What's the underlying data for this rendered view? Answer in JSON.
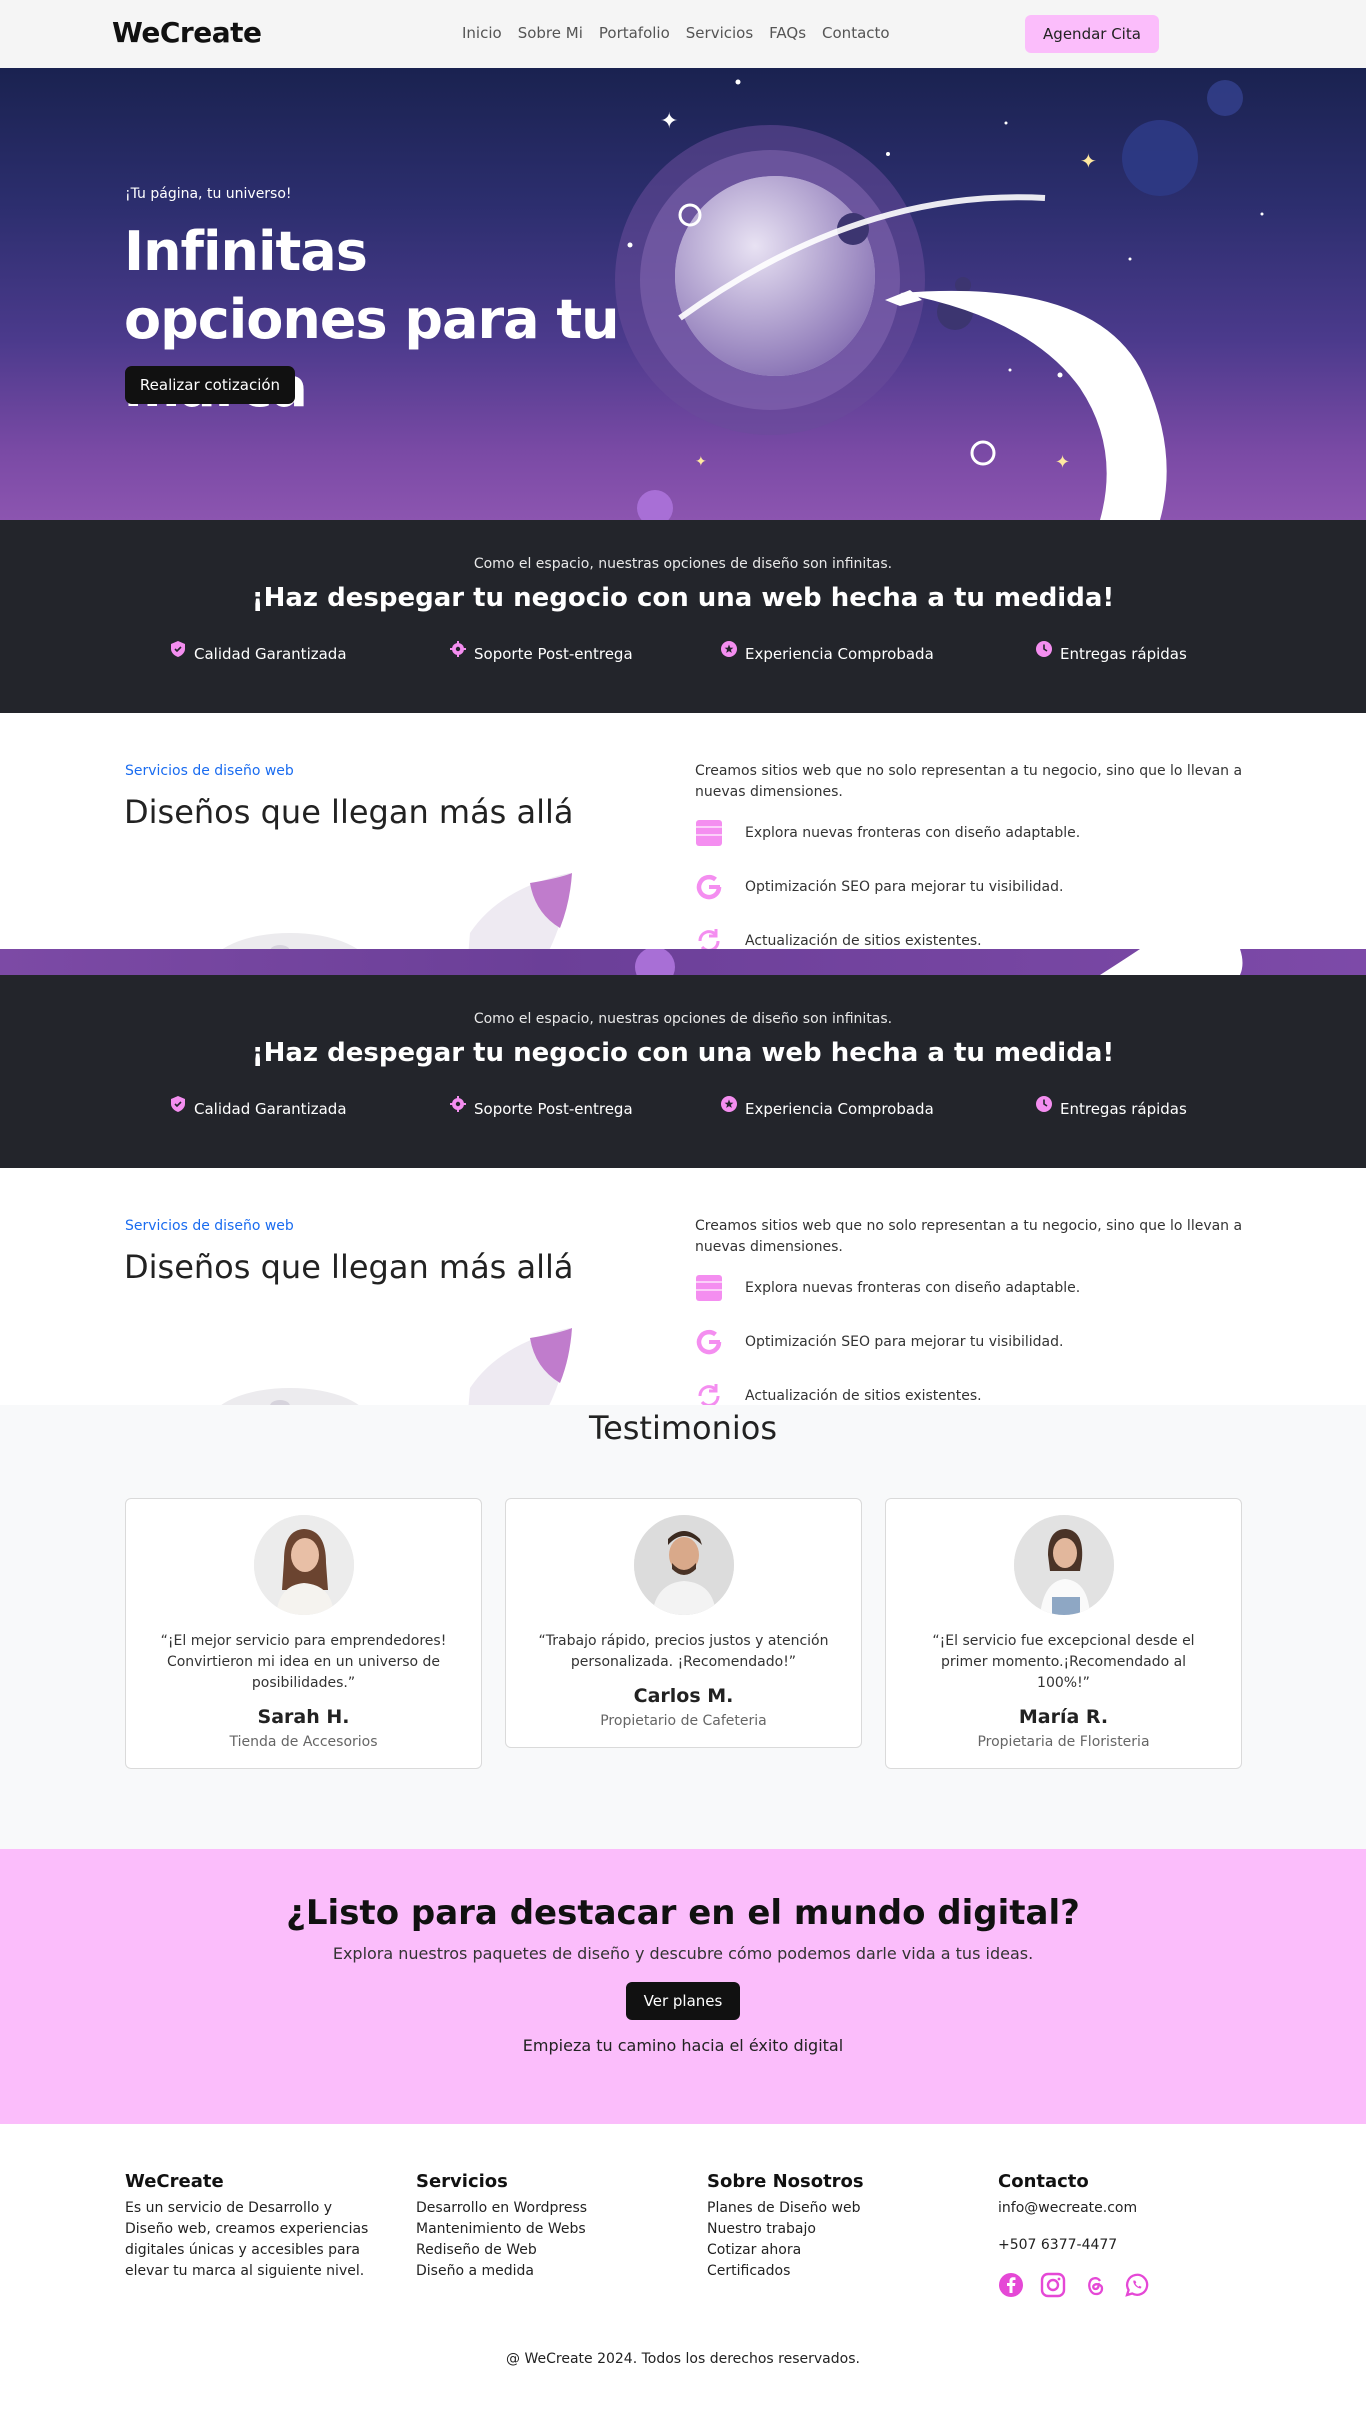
{
  "nav": {
    "brand": "WeCreate",
    "links": [
      "Inicio",
      "Sobre Mi",
      "Portafolio",
      "Servicios",
      "FAQs",
      "Contacto"
    ],
    "cta": "Agendar Cita"
  },
  "hero": {
    "tag": "¡Tu página, tu universo!",
    "title": "Infinitas opciones para tu marca",
    "button": "Realizar cotización"
  },
  "band": {
    "subtitle": "Como el espacio, nuestras opciones de diseño son infinitas.",
    "title": "¡Haz despegar tu negocio con una web hecha a tu medida!",
    "features": [
      {
        "icon": "shield-check-icon",
        "label": "Calidad Garantizada"
      },
      {
        "icon": "gear-icon",
        "label": "Soporte Post-entrega"
      },
      {
        "icon": "star-badge-icon",
        "label": "Experiencia Comprobada"
      },
      {
        "icon": "clock-icon",
        "label": "Entregas rápidas"
      }
    ]
  },
  "services": {
    "eyebrow": "Servicios de diseño web",
    "title": "Diseños que llegan más allá",
    "intro": "Creamos sitios web que no solo representan a tu negocio, sino que lo llevan a nuevas dimensiones.",
    "items": [
      {
        "icon": "layout-icon",
        "label": "Explora nuevas fronteras con diseño adaptable."
      },
      {
        "icon": "google-icon",
        "label": "Optimización SEO para mejorar tu visibilidad."
      },
      {
        "icon": "refresh-icon",
        "label": "Actualización de sitios existentes."
      }
    ]
  },
  "testimonials": {
    "title": "Testimonios",
    "items": [
      {
        "quote": "“¡El mejor servicio para emprendedores! Convirtieron mi idea en un universo de posibilidades.”",
        "name": "Sarah H.",
        "role": "Tienda de Accesorios"
      },
      {
        "quote": "“Trabajo rápido, precios justos y atención personalizada. ¡Recomendado!”",
        "name": "Carlos M.",
        "role": "Propietario de Cafeteria"
      },
      {
        "quote": "“¡El servicio fue excepcional desde el primer momento.¡Recomendado al 100%!”",
        "name": "María R.",
        "role": "Propietaria de Floristeria"
      }
    ]
  },
  "cta": {
    "title": "¿Listo para destacar en el mundo digital?",
    "subtitle": "Explora nuestros paquetes de diseño y descubre cómo podemos darle vida a tus ideas.",
    "button": "Ver planes",
    "tail": "Empieza tu camino hacia el éxito digital"
  },
  "footer": {
    "col1": {
      "title": "WeCreate",
      "text": "Es un servicio de Desarrollo y Diseño web, creamos experiencias digitales únicas y accesibles para elevar tu marca al siguiente nivel."
    },
    "col2": {
      "title": "Servicios",
      "links": [
        "Desarrollo en Wordpress",
        "Mantenimiento de Webs",
        "Rediseño de Web",
        "Diseño a medida"
      ]
    },
    "col3": {
      "title": "Sobre Nosotros",
      "links": [
        "Planes de Diseño web",
        "Nuestro trabajo",
        "Cotizar ahora",
        "Certificados"
      ]
    },
    "col4": {
      "title": "Contacto",
      "email": "info@wecreate.com",
      "phone": "+507 6377-4477",
      "socials": [
        "facebook-icon",
        "instagram-icon",
        "threads-icon",
        "whatsapp-icon"
      ]
    },
    "copyright": "@ WeCreate 2024. Todos los derechos reservados."
  },
  "colors": {
    "accent": "#fbbdfb",
    "icon_pink": "#f48ef0",
    "band_bg": "#23252b",
    "link_blue": "#1a6cf0"
  }
}
